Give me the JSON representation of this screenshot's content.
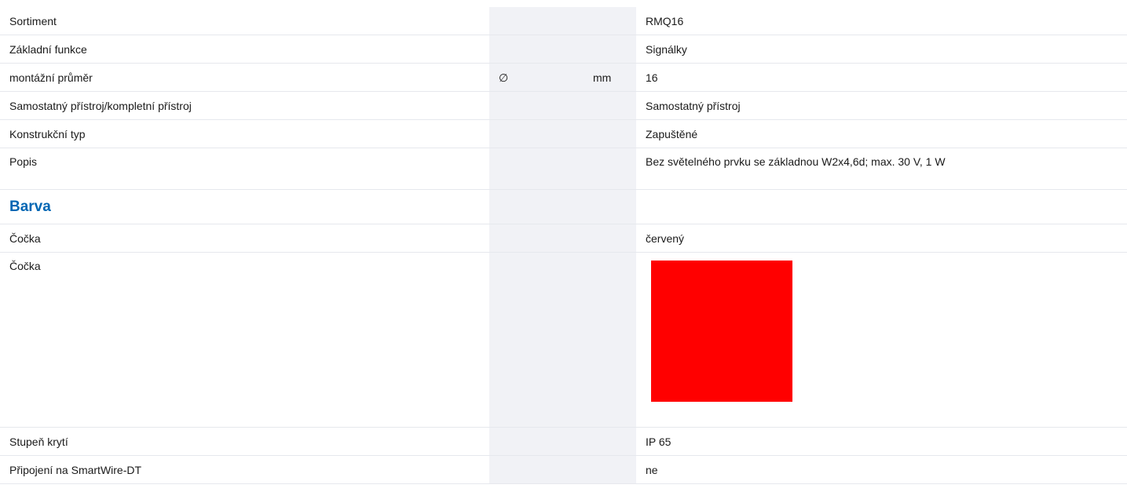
{
  "colors": {
    "accent": "#0066b3",
    "symbol_column_bg": "#f1f2f6",
    "lens_swatch": "#ff0000"
  },
  "rows": {
    "sortiment": {
      "label": "Sortiment",
      "value": "RMQ16"
    },
    "zakladni_funkce": {
      "label": "Základní funkce",
      "value": "Signálky"
    },
    "montazni_prumer": {
      "label": "montážní průměr",
      "symbol": "∅",
      "unit": "mm",
      "value": "16"
    },
    "samostatny": {
      "label": "Samostatný přístroj/kompletní přístroj",
      "value": "Samostatný přístroj"
    },
    "konstrukcni_typ": {
      "label": "Konstrukční typ",
      "value": "Zapuštěné"
    },
    "popis": {
      "label": "Popis",
      "value": "Bez světelného prvku\nse základnou W2x4,6d; max. 30 V, 1 W"
    },
    "barva_section": {
      "label": "Barva"
    },
    "cocka_text": {
      "label": "Čočka",
      "value": "červený"
    },
    "cocka_swatch": {
      "label": "Čočka",
      "swatch_color": "#ff0000"
    },
    "stupen_kryti": {
      "label": "Stupeň krytí",
      "value": "IP 65"
    },
    "smartwire": {
      "label": "Připojení na SmartWire-DT",
      "value": "ne"
    }
  }
}
